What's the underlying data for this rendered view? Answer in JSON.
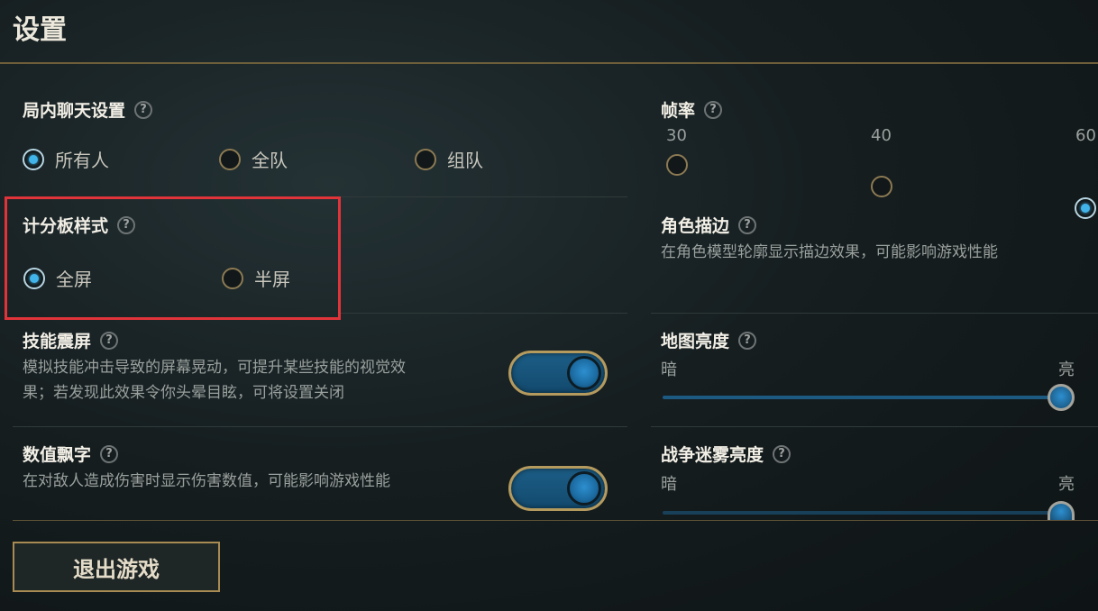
{
  "title": "设置",
  "chat": {
    "title": "局内聊天设置",
    "options": [
      "所有人",
      "全队",
      "组队"
    ],
    "selected": "所有人"
  },
  "framerate": {
    "title": "帧率",
    "options": [
      "30",
      "40",
      "60"
    ],
    "selected": "60"
  },
  "scoreboard": {
    "title": "计分板样式",
    "options": [
      "全屏",
      "半屏"
    ],
    "selected": "全屏"
  },
  "outline": {
    "title": "角色描边",
    "desc": "在角色模型轮廓显示描边效果，可能影响游戏性能"
  },
  "shake": {
    "title": "技能震屏",
    "desc_line1": "模拟技能冲击导致的屏幕晃动，可提升某些技能的视觉效",
    "desc_line2": "果；若发现此效果令你头晕目眩，可将设置关闭",
    "enabled": true
  },
  "map_brightness": {
    "title": "地图亮度",
    "min_label": "暗",
    "max_label": "亮",
    "value": 1.0
  },
  "damage_numbers": {
    "title": "数值飘字",
    "desc": "在对敌人造成伤害时显示伤害数值，可能影响游戏性能",
    "enabled": true
  },
  "fog_brightness": {
    "title": "战争迷雾亮度",
    "min_label": "暗",
    "max_label": "亮"
  },
  "exit_button": "退出游戏",
  "help_symbol": "?",
  "colors": {
    "accent": "#41b4e9",
    "gold": "#a78b52",
    "highlight": "#e0343a"
  }
}
